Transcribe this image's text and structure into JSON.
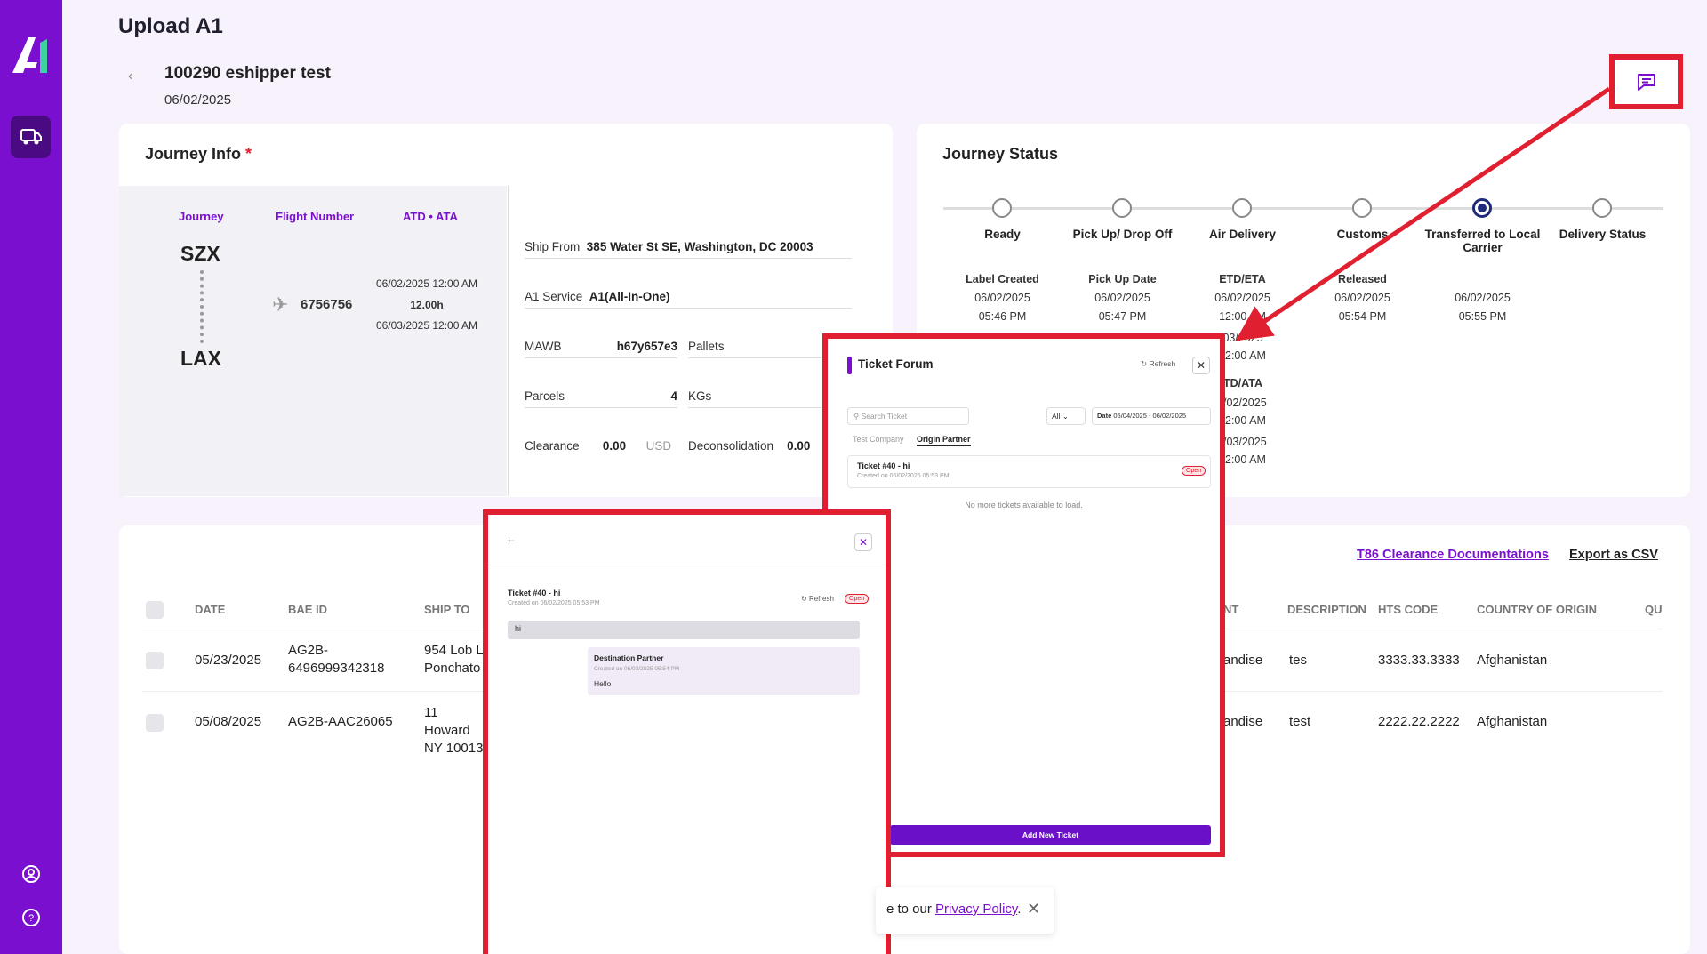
{
  "sidebar": {
    "logo_text": "A1",
    "nav_icon": "truck-icon",
    "profile_icon": "user-circle-icon",
    "help_icon": "help-circle-icon"
  },
  "header": {
    "title": "Upload A1",
    "order_name": "100290 eshipper test",
    "order_date": "06/02/2025"
  },
  "journey_info": {
    "title": "Journey Info",
    "required_mark": "*",
    "col_journey": "Journey",
    "col_flight": "Flight Number",
    "col_atd_ata": "ATD • ATA",
    "origin": "SZX",
    "destination": "LAX",
    "flight_number": "6756756",
    "departure": "06/02/2025 12:00 AM",
    "duration": "12.00h",
    "arrival": "06/03/2025 12:00 AM",
    "ship_from_label": "Ship From",
    "ship_from_value": "385 Water St SE, Washington, DC 20003",
    "service_label": "A1 Service",
    "service_value": "A1(All-In-One)",
    "mawb_label": "MAWB",
    "mawb_value": "h67y657e3",
    "pallets_label": "Pallets",
    "parcels_label": "Parcels",
    "parcels_value": "4",
    "kgs_label": "KGs",
    "clearance_label": "Clearance",
    "clearance_value": "0.00",
    "clearance_currency": "USD",
    "decon_label": "Deconsolidation",
    "decon_value": "0.00"
  },
  "journey_status": {
    "title": "Journey Status",
    "steps": [
      {
        "label": "Ready",
        "sub_label": "Label Created",
        "date": "06/02/2025",
        "time": "05:46 PM"
      },
      {
        "label": "Pick Up/ Drop Off",
        "sub_label": "Pick Up Date",
        "date": "06/02/2025",
        "time": "05:47 PM"
      },
      {
        "label": "Air Delivery",
        "sub_label": "ETD/ETA",
        "date": "06/02/2025",
        "time": "12:00 AM"
      },
      {
        "label": "Customs",
        "sub_label": "Released",
        "date": "06/02/2025",
        "time": "05:54 PM"
      },
      {
        "label": "Transferred to Local Carrier",
        "sub_label": "",
        "date": "06/02/2025",
        "time": "05:55 PM"
      },
      {
        "label": "Delivery Status",
        "sub_label": "",
        "date": "",
        "time": ""
      }
    ],
    "air_extra": [
      "/03/2025",
      "2:00 AM",
      "TD/ATA",
      "/02/2025",
      "2:00 AM",
      "/03/2025",
      "2:00 AM"
    ]
  },
  "table": {
    "link_t86": "T86 Clearance Documentations",
    "link_export": "Export as CSV",
    "headers": [
      "DATE",
      "BAE ID",
      "SHIP TO",
      "NT",
      "DESCRIPTION",
      "HTS CODE",
      "COUNTRY OF ORIGIN",
      "QU"
    ],
    "rows": [
      {
        "date": "05/23/2025",
        "bae_id": "AG2B-6496999342318",
        "ship_to": "954 Lob L Ponchato",
        "content": "andise",
        "description": "tes",
        "hts": "3333.33.3333",
        "origin": "Afghanistan"
      },
      {
        "date": "05/08/2025",
        "bae_id": "AG2B-AAC26065",
        "ship_to": "11 Howard NY 10013",
        "content": "andise",
        "description": "test",
        "hts": "2222.22.2222",
        "origin": "Afghanistan"
      }
    ]
  },
  "ticket_forum": {
    "title": "Ticket Forum",
    "refresh": "Refresh",
    "search_placeholder": "Search Ticket",
    "filter_all": "All",
    "date_label": "Date",
    "date_range": "05/04/2025 - 06/02/2025",
    "tab_1": "Test Company",
    "tab_2": "Origin Partner",
    "ticket_title": "Ticket #40 - hi",
    "ticket_created": "Created on 06/02/2025 05:53 PM",
    "ticket_status": "Open",
    "no_more": "No more tickets available to load.",
    "add_button": "Add New Ticket"
  },
  "ticket_chat": {
    "ticket_title": "Ticket #40 - hi",
    "ticket_created": "Created on 06/02/2025 05:53 PM",
    "refresh": "Refresh",
    "status": "Open",
    "message_1": "hi",
    "reply_author": "Destination Partner",
    "reply_time": "Created on 06/02/2025 05:54 PM",
    "reply_text": "Hello"
  },
  "cookie": {
    "prefix": "e to our",
    "link": "Privacy Policy",
    "suffix": "."
  },
  "colors": {
    "brand": "#7b0fcf",
    "highlight": "#e02030",
    "status_active": "#1e2a7a"
  }
}
